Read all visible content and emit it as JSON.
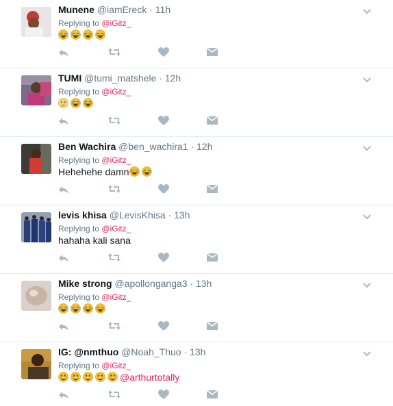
{
  "colors": {
    "mention": "#e0245e",
    "meta": "#657786",
    "action_icon": "#aab8c2",
    "divider": "#e6ecf0"
  },
  "icons": {
    "caret": "chevron-down-icon",
    "reply": "reply-icon",
    "retweet": "retweet-icon",
    "like": "heart-icon",
    "dm": "direct-message-icon"
  },
  "tweets": [
    {
      "name": "Munene",
      "handle": "@iamEreck",
      "sep": "·",
      "time": "11h",
      "reply_prefix": "Replying to",
      "reply_to": "@iGitz_",
      "text": "",
      "emojis_before": [
        "joy",
        "joy",
        "joy",
        "joy"
      ],
      "trailing_mention": ""
    },
    {
      "name": "TUMI",
      "handle": "@tumi_matshele",
      "sep": "·",
      "time": "12h",
      "reply_prefix": "Replying to",
      "reply_to": "@iGitz_",
      "text": "",
      "emojis_before": [
        "neutral",
        "joy",
        "joy"
      ],
      "trailing_mention": ""
    },
    {
      "name": "Ben Wachira",
      "handle": "@ben_wachira1",
      "sep": "·",
      "time": "12h",
      "reply_prefix": "Replying to",
      "reply_to": "@iGitz_",
      "text": "Hehehehe damn",
      "emojis_after": [
        "joy",
        "joy"
      ],
      "trailing_mention": ""
    },
    {
      "name": "levis khisa",
      "handle": "@LevisKhisa",
      "sep": "·",
      "time": "13h",
      "reply_prefix": "Replying to",
      "reply_to": "@iGitz_",
      "text": "hahaha kali sana",
      "trailing_mention": ""
    },
    {
      "name": "Mike strong",
      "handle": "@apollonganga3",
      "sep": "·",
      "time": "13h",
      "reply_prefix": "Replying to",
      "reply_to": "@iGitz_",
      "text": "",
      "emojis_before": [
        "joy",
        "joy",
        "joy",
        "joy"
      ],
      "trailing_mention": ""
    },
    {
      "name": "IG: @nmthuo",
      "handle": "@Noah_Thuo",
      "sep": "·",
      "time": "13h",
      "reply_prefix": "Replying to",
      "reply_to": "@iGitz_",
      "text": "",
      "emojis_before": [
        "grin",
        "grin",
        "grin",
        "grin",
        "grin"
      ],
      "trailing_mention": "@arthurtotally"
    }
  ]
}
